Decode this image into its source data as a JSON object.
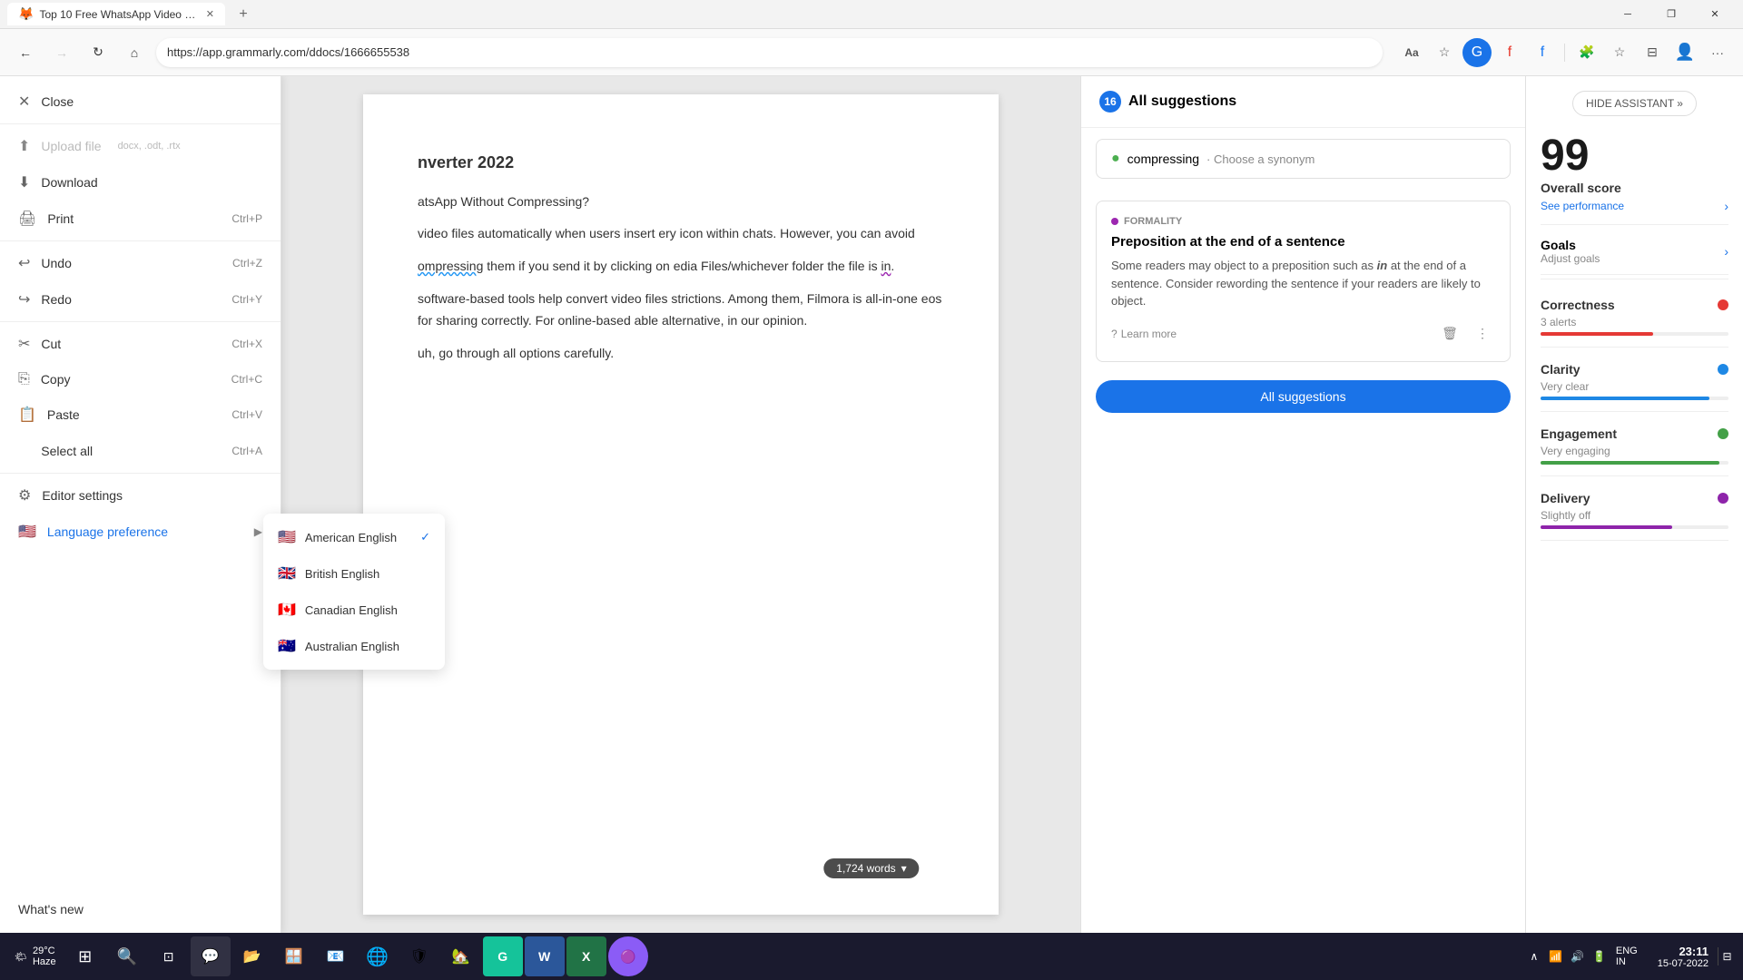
{
  "browser": {
    "tab": {
      "title": "Top 10 Free WhatsApp Video Co...",
      "favicon": "🦊",
      "close": "✕"
    },
    "newtab": "+",
    "window_controls": {
      "minimize": "─",
      "maximize": "❐",
      "close": "✕"
    },
    "address": "https://app.grammarly.com/ddocs/1666655538",
    "toolbar": {
      "reader_icon": "Aa",
      "star_icon": "☆",
      "extensions_icon": "🧩",
      "more_icon": "···"
    }
  },
  "left_menu": {
    "close_label": "Close",
    "upload_label": "Upload file",
    "upload_hint": "docx, .odt, .rtx",
    "download_label": "Download",
    "print_label": "Print",
    "print_shortcut": "Ctrl+P",
    "undo_label": "Undo",
    "undo_shortcut": "Ctrl+Z",
    "redo_label": "Redo",
    "redo_shortcut": "Ctrl+Y",
    "cut_label": "Cut",
    "cut_shortcut": "Ctrl+X",
    "copy_label": "Copy",
    "copy_shortcut": "Ctrl+C",
    "paste_label": "Paste",
    "paste_shortcut": "Ctrl+V",
    "selectall_label": "Select all",
    "selectall_shortcut": "Ctrl+A",
    "editor_settings_label": "Editor settings",
    "language_label": "Language preference",
    "whats_new_label": "What's new"
  },
  "language_submenu": {
    "american": "American English",
    "british": "British English",
    "canadian": "Canadian English",
    "australian": "Australian English"
  },
  "document": {
    "title": "nverter 2022",
    "para1": "atsApp Without Compressing?",
    "para2": "video files automatically when users insert ery icon within chats. However, you can avoid",
    "para2b": "ompressing",
    "para2c": " them if you send it by clicking on edia Files/whichever folder the file is ",
    "para2d": "in",
    "para3": "software-based tools help convert video files strictions. Among them, Filmora is all-in-one eos for sharing correctly. For online-based able alternative, in our opinion.",
    "para4": "uh, go through all options carefully.",
    "word_count": "1,724 words"
  },
  "suggestions": {
    "count": "16",
    "title": "All suggestions",
    "synonym_word": "compressing",
    "synonym_action": "· Choose a synonym",
    "formality_tag": "FORMALITY",
    "card_heading": "Preposition at the end of a sentence",
    "card_body_start": "Some readers may object to a preposition such as ",
    "card_body_em": "in",
    "card_body_end": " at the end of a sentence. Consider rewording the sentence if your readers are likely to object.",
    "learn_more": "Learn more",
    "all_suggestions_btn": "All suggestions"
  },
  "score_panel": {
    "hide_assistant": "HIDE ASSISTANT »",
    "score": "99",
    "overall_label": "Overall score",
    "see_performance": "See performance",
    "goals_label": "Goals",
    "adjust_goals": "Adjust goals",
    "correctness_label": "Correctness",
    "correctness_sub": "3 alerts",
    "correctness_color": "#e53935",
    "correctness_fill": "60%",
    "clarity_label": "Clarity",
    "clarity_sub": "Very clear",
    "clarity_color": "#1e88e5",
    "clarity_fill": "90%",
    "engagement_label": "Engagement",
    "engagement_sub": "Very engaging",
    "engagement_color": "#43a047",
    "engagement_fill": "95%",
    "delivery_label": "Delivery",
    "delivery_sub": "Slightly off",
    "delivery_color": "#8e24aa",
    "delivery_fill": "70%"
  },
  "taskbar": {
    "weather_temp": "29°C",
    "weather_desc": "Haze",
    "weather_icon": "🌤",
    "lang": "ENG",
    "lang_sub": "IN",
    "time": "23:11",
    "date": "15-07-2022",
    "apps": [
      "⊞",
      "🔍",
      "📁",
      "💬",
      "📂",
      "🪟",
      "📧",
      "🌐",
      "🛡",
      "🏡",
      "🌐",
      "W",
      "X",
      "🟣"
    ]
  }
}
